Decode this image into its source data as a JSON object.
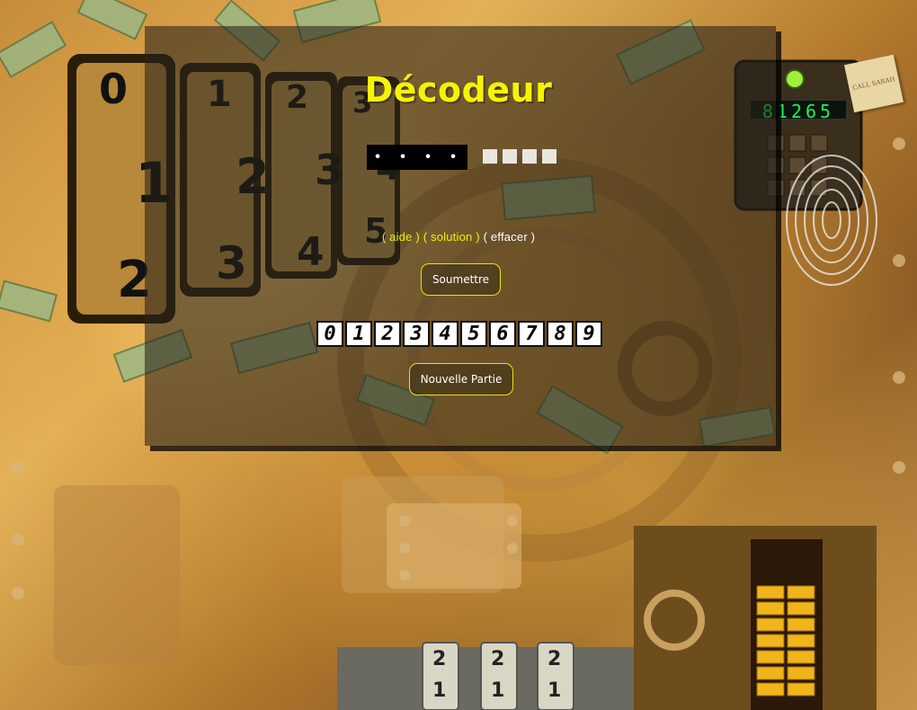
{
  "game": {
    "title": "Décodeur",
    "code_slots": [
      "•",
      "•",
      "•",
      "•"
    ],
    "feedback_pegs": 4,
    "links": {
      "aide": "( aide )",
      "solution": "( solution )",
      "effacer": "( effacer )"
    },
    "submit_label": "Soumettre",
    "new_game_label": "Nouvelle Partie",
    "digits": [
      "0",
      "1",
      "2",
      "3",
      "4",
      "5",
      "6",
      "7",
      "8",
      "9"
    ]
  },
  "background": {
    "dial_top": [
      "0",
      "1",
      "2",
      "3"
    ],
    "dial_middle": [
      "1",
      "2",
      "3",
      "4"
    ],
    "dial_bottom": [
      "2",
      "3",
      "4",
      "5"
    ],
    "keypad_display": "81265",
    "note_text": "CALL SARAH",
    "bottom_dials_top": [
      "2",
      "2",
      "2"
    ],
    "bottom_dials_middle": [
      "1",
      "1",
      "1"
    ]
  },
  "colors": {
    "title": "#f6f400",
    "link": "#f2f200",
    "button_border": "#e6e600",
    "panel": "rgba(40,35,25,0.58)"
  }
}
